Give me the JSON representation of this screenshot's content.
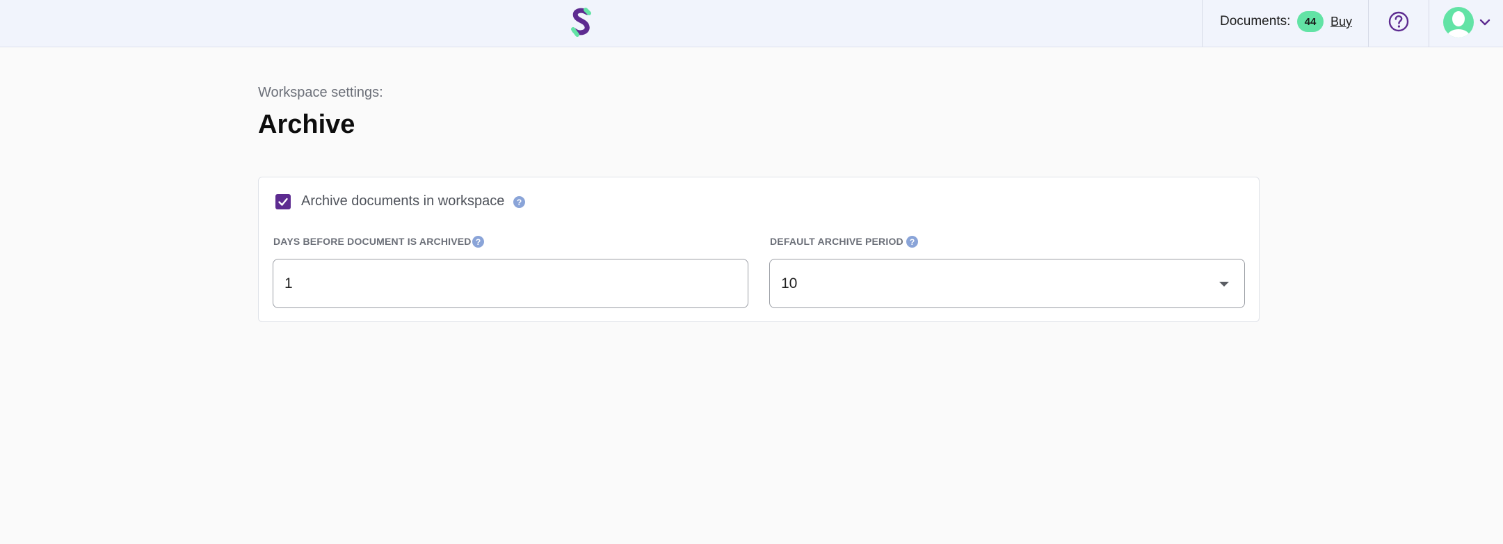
{
  "header": {
    "logo_icon": "scribble-s-logo-icon",
    "documents_label": "Documents:",
    "documents_count": "44",
    "buy_label": "Buy",
    "help_icon": "question-circle-icon",
    "avatar_icon": "user-avatar-icon",
    "menu_icon": "chevron-down-icon"
  },
  "page": {
    "subtitle": "Workspace settings:",
    "title": "Archive"
  },
  "settings": {
    "archive_checkbox": {
      "label": "Archive documents in workspace",
      "checked": true
    },
    "days_field": {
      "label": "DAYS BEFORE DOCUMENT IS ARCHIVED",
      "value": "1"
    },
    "period_field": {
      "label": "DEFAULT ARCHIVE PERIOD",
      "value": "10"
    }
  },
  "colors": {
    "brand_purple": "#5d2b90",
    "brand_green": "#62e3a5",
    "header_bg": "#f1f4fc",
    "info_icon": "#8aa4d8"
  }
}
